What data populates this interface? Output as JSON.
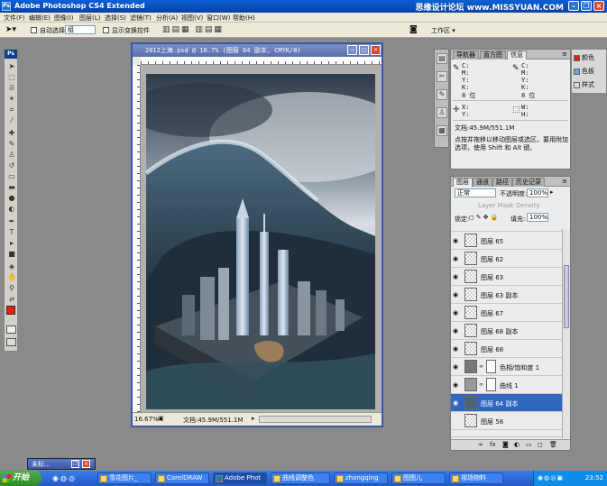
{
  "app": {
    "title": "Adobe Photoshop CS4 Extended",
    "icon_label": "Ps",
    "watermark": "思缘设计论坛 www.MISSYUAN.COM",
    "window_controls": [
      "minimize-icon",
      "restore-icon",
      "close-icon"
    ]
  },
  "menubar": {
    "items": [
      "文件(F)",
      "编辑(E)",
      "图像(I)",
      "图层(L)",
      "选择(S)",
      "滤镜(T)",
      "分析(A)",
      "视图(V)",
      "窗口(W)",
      "帮助(H)"
    ]
  },
  "options": {
    "auto_select_label": "自动选择:",
    "auto_select_value": "组",
    "show_transform_label": "显示变换控件",
    "workspace_label": "工作区 ▾"
  },
  "toolbox": {
    "header": "Ps",
    "foreground_color": "#e02010",
    "background_color": "#ffffff"
  },
  "document": {
    "title": "2012上海.psd @ 16.7% (图层 64 副本, CMYK/8)",
    "zoom": "16.67%",
    "doc_size": "文档:45.9M/551.1M"
  },
  "info_panel": {
    "tabs": [
      "导航器",
      "直方图",
      "信息"
    ],
    "cmyk_left": [
      "C:",
      "M:",
      "Y:",
      "K:",
      "8 位"
    ],
    "cmyk_right": [
      "C:",
      "M:",
      "Y:",
      "K:",
      "8 位"
    ],
    "xy": [
      "X:",
      "Y:"
    ],
    "wh": [
      "W:",
      "H:"
    ],
    "doc_size": "文档:45.9M/551.1M",
    "hint": "点按并拖移以移动图层或选区。要用附加选项，使用 Shift 和 Alt 键。"
  },
  "color_panel": {
    "items": [
      "颜色",
      "色板",
      "样式"
    ]
  },
  "layers_panel": {
    "tabs": [
      "图层",
      "通道",
      "路径",
      "历史记录"
    ],
    "blend_mode": "正常",
    "opacity_label": "不透明度:",
    "opacity_value": "100%",
    "mask_density": "Layer Mask Density",
    "lock_label": "锁定:",
    "fill_label": "填充:",
    "fill_value": "100%",
    "layers": [
      {
        "name": "图层 65",
        "type": "normal",
        "selected": false,
        "visible": true
      },
      {
        "name": "图层 62",
        "type": "normal",
        "selected": false,
        "visible": true
      },
      {
        "name": "图层 63",
        "type": "normal",
        "selected": false,
        "visible": true
      },
      {
        "name": "图层 63 副本",
        "type": "normal",
        "selected": false,
        "visible": true
      },
      {
        "name": "图层 67",
        "type": "normal",
        "selected": false,
        "visible": true
      },
      {
        "name": "图层 68 副本",
        "type": "normal",
        "selected": false,
        "visible": true
      },
      {
        "name": "图层 68",
        "type": "normal",
        "selected": false,
        "visible": true
      },
      {
        "name": "色相/饱和度 1",
        "type": "adjustment",
        "selected": false,
        "visible": true
      },
      {
        "name": "曲线 1",
        "type": "adjustment",
        "selected": false,
        "visible": true
      },
      {
        "name": "图层 64 副本",
        "type": "normal",
        "selected": true,
        "visible": true
      },
      {
        "name": "图层 58",
        "type": "normal",
        "selected": false,
        "visible": false
      }
    ],
    "footer_icons": [
      "link-icon",
      "fx-icon",
      "mask-icon",
      "adjustment-icon",
      "group-icon",
      "new-layer-icon",
      "trash-icon"
    ]
  },
  "minimized": {
    "label": "未标..."
  },
  "taskbar": {
    "start": "开始",
    "buttons": [
      "雪花图片_",
      "CorelDRAW",
      "Adobe Phot",
      "曲线调整色",
      "zhongqing",
      "图图儿",
      "视场物料"
    ],
    "active_index": 2,
    "clock": "23:52"
  }
}
